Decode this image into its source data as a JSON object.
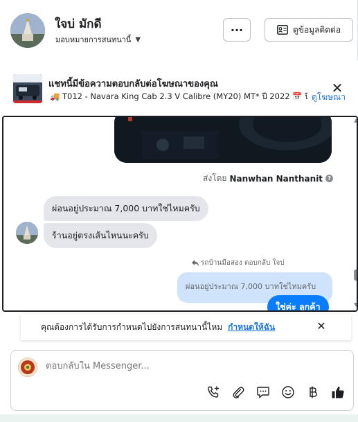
{
  "header": {
    "name": "ใจบ่ มักดี",
    "assign_label": "มอบหมายการสนทนานี้",
    "more_label": "···",
    "contact_label": "ดูข้อมูลติดต่อ"
  },
  "ad": {
    "title": "แชทนี้มีข้อความตอบกลับต่อโฆษณาของคุณ",
    "subtitle": "🚚 T012 - Navara King Cab 2.3 V Calibre (MY20) MT* ปี 2022 📅 ปี ...",
    "link": "ดูโฆษณา"
  },
  "chat": {
    "sent_by_prefix": "ส่งโดย",
    "sent_by_name": "Nanwhan Nanthanit",
    "messages_in": [
      "ผ่อนอยู่ประมาณ 7,000 บาทใช่ไหมครับ",
      "ร้านอยู่ตรงเส้นไหนนะครับ"
    ],
    "reply_note": "รถบ้านมือสอง ตอบกลับ ใจบ่",
    "reply_quote": "ผ่อนอยู่ประมาณ 7,000 บาทใช่ไหมครับ",
    "message_out": "ใช่ค่ะ ลูกค้า"
  },
  "prompt": {
    "text": "คุณต้องการได้รับการกำหนดไปยังการสนทนานี้ไหม",
    "link": "กำหนดให้ฉัน"
  },
  "composer": {
    "placeholder": "ตอบกลับใน Messenger..."
  },
  "icons": {
    "tools": [
      "phone-add-icon",
      "paperclip-icon",
      "saved-reply-icon",
      "emoji-icon",
      "baht-icon",
      "thumbs-up-icon"
    ]
  },
  "colors": {
    "accent": "#0a7cff",
    "link": "#1b74e4",
    "incoming_bubble": "#e4e6eb",
    "quoted_bubble": "#cfe4fc"
  }
}
